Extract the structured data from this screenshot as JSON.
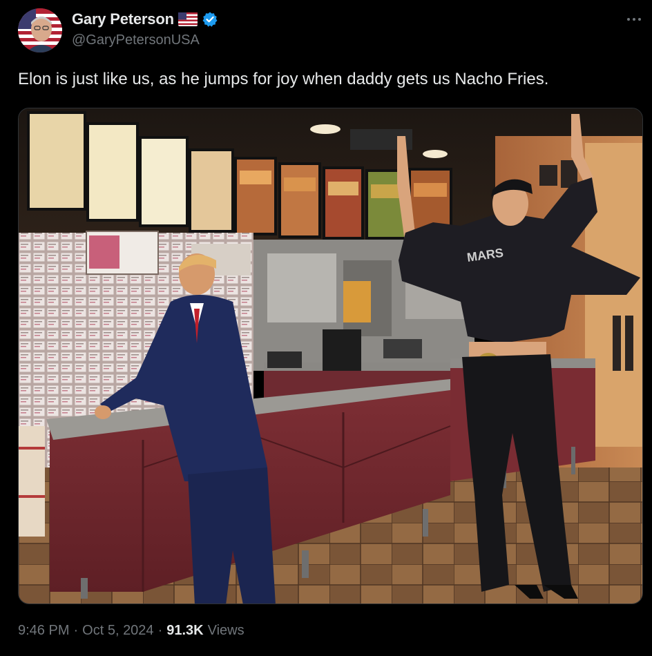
{
  "post": {
    "author": {
      "display_name": "Gary Peterson",
      "handle": "@GaryPetersonUSA",
      "flag_icon": "us-flag-icon",
      "verified_icon": "verified-badge-icon",
      "verified_color": "#1d9bf0"
    },
    "text": "Elon is just like us, as he jumps for joy when daddy gets us Nacho Fries.",
    "media": {
      "shirt_text": "MARS"
    },
    "time": "9:46 PM",
    "date": "Oct 5, 2024",
    "views_count": "91.3K",
    "views_label": "Views",
    "separator": "·",
    "more_icon": "more-horizontal-icon"
  },
  "colors": {
    "background": "#000000",
    "primary_text": "#e7e9ea",
    "secondary_text": "#71767b",
    "accent": "#1d9bf0"
  }
}
